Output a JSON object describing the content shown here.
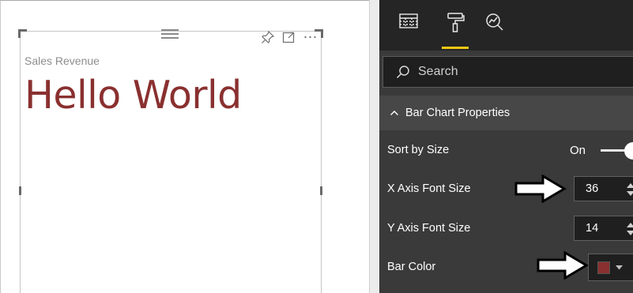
{
  "visual": {
    "title": "Sales Revenue",
    "text": "Hello World",
    "text_color": "#8a3030",
    "more_options_label": "⋯"
  },
  "format_pane": {
    "tabs": [
      {
        "icon": "fields-grid-icon",
        "active": false
      },
      {
        "icon": "paint-roller-icon",
        "active": true
      },
      {
        "icon": "analytics-magnifier-icon",
        "active": false
      }
    ],
    "search": {
      "placeholder": "Search"
    },
    "section": {
      "label": "Bar Chart Properties",
      "expanded": true
    },
    "properties": {
      "sort_by_size": {
        "label": "Sort by Size",
        "value": "On"
      },
      "x_axis_font_size": {
        "label": "X Axis Font Size",
        "value": "36"
      },
      "y_axis_font_size": {
        "label": "Y Axis Font Size",
        "value": "14"
      },
      "bar_color": {
        "label": "Bar Color",
        "value": "#8a3030"
      }
    },
    "accent_color": "#f2c811"
  }
}
